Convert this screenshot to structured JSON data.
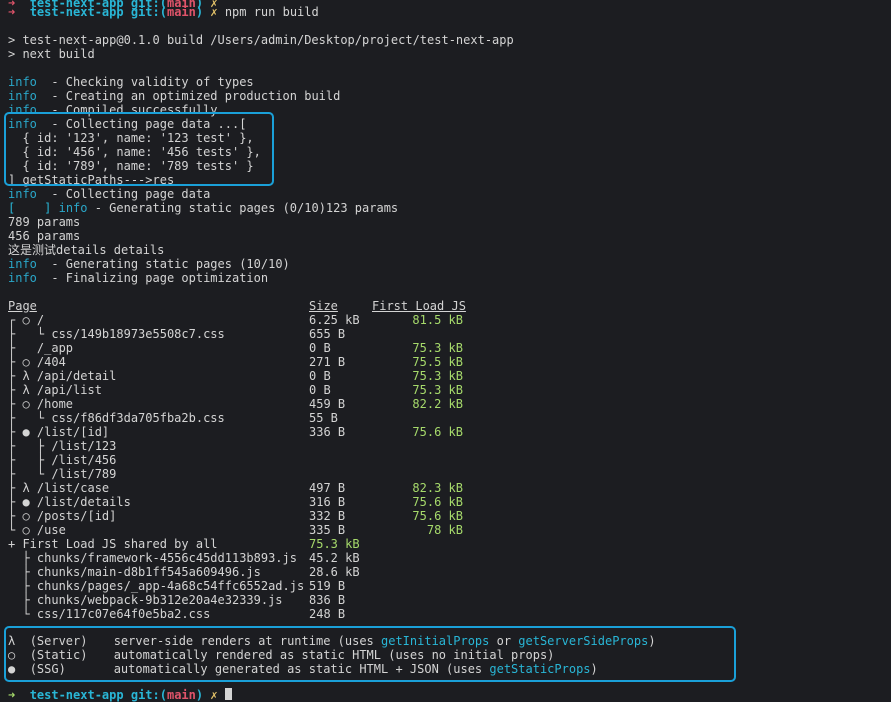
{
  "prompt_top": {
    "arrow": "➜",
    "dir": "test-next-app",
    "git_label": "git:(",
    "branch": "main",
    "git_close": ")",
    "dirty": "✗",
    "command": "npm run build"
  },
  "npm_header": [
    "> test-next-app@0.1.0 build /Users/admin/Desktop/project/test-next-app",
    "> next build"
  ],
  "info_label": "info",
  "info_lines_1": [
    "- Checking validity of types",
    "- Creating an optimized production build",
    "- Compiled successfully",
    "- Collecting page data ...["
  ],
  "paths_output": [
    "  { id: '123', name: '123 test' },",
    "  { id: '456', name: '456 tests' },",
    "  { id: '789', name: '789 tests' }",
    "] getStaticPaths--->res"
  ],
  "collect_line": "- Collecting page data",
  "gen_line": {
    "bracket": "[    ]",
    "label": "info",
    "text": " - Generating static pages (0/10)123 params"
  },
  "params": [
    "789 params",
    "456 params",
    "这是测试details details"
  ],
  "info_lines_2": [
    "- Generating static pages (10/10)",
    "- Finalizing page optimization"
  ],
  "table": {
    "headers": {
      "page": "Page",
      "size": "Size",
      "first_load": "First Load JS"
    },
    "rows": [
      {
        "page": "┌ ○ /",
        "size": "6.25 kB",
        "first": "81.5 kB"
      },
      {
        "page": "├   └ css/149b18973e5508c7.css",
        "size": "655 B",
        "first": ""
      },
      {
        "page": "├   /_app",
        "size": "0 B",
        "first": "75.3 kB"
      },
      {
        "page": "├ ○ /404",
        "size": "271 B",
        "first": "75.5 kB"
      },
      {
        "page": "├ λ /api/detail",
        "size": "0 B",
        "first": "75.3 kB"
      },
      {
        "page": "├ λ /api/list",
        "size": "0 B",
        "first": "75.3 kB"
      },
      {
        "page": "├ ○ /home",
        "size": "459 B",
        "first": "82.2 kB"
      },
      {
        "page": "├   └ css/f86df3da705fba2b.css",
        "size": "55 B",
        "first": ""
      },
      {
        "page": "├ ● /list/[id]",
        "size": "336 B",
        "first": "75.6 kB"
      },
      {
        "page": "├   ├ /list/123",
        "size": "",
        "first": ""
      },
      {
        "page": "├   ├ /list/456",
        "size": "",
        "first": ""
      },
      {
        "page": "├   └ /list/789",
        "size": "",
        "first": ""
      },
      {
        "page": "├ λ /list/case",
        "size": "497 B",
        "first": "82.3 kB"
      },
      {
        "page": "├ ● /list/details",
        "size": "316 B",
        "first": "75.6 kB"
      },
      {
        "page": "├ ○ /posts/[id]",
        "size": "332 B",
        "first": "75.6 kB"
      },
      {
        "page": "└ ○ /use",
        "size": "335 B",
        "first": "78 kB"
      }
    ],
    "shared": {
      "label": "+ First Load JS shared by all",
      "size": "75.3 kB"
    },
    "chunks": [
      {
        "name": "  ├ chunks/framework-4556c45dd113b893.js",
        "size": "45.2 kB"
      },
      {
        "name": "  ├ chunks/main-d8b1ff545a609496.js",
        "size": "28.6 kB"
      },
      {
        "name": "  ├ chunks/pages/_app-4a68c54ffc6552ad.js",
        "size": "519 B"
      },
      {
        "name": "  ├ chunks/webpack-9b312e20a4e32339.js",
        "size": "836 B"
      },
      {
        "name": "  └ css/117c07e64f0e5ba2.css",
        "size": "248 B"
      }
    ]
  },
  "legend": [
    {
      "sym": "λ",
      "kind": "(Server)",
      "text": "server-side renders at runtime (uses ",
      "k1": "getInitialProps",
      "mid": " or ",
      "k2": "getServerSideProps",
      "end": ")"
    },
    {
      "sym": "○",
      "kind": "(Static)",
      "text": "automatically rendered as static HTML (uses no initial props)",
      "k1": "",
      "mid": "",
      "k2": "",
      "end": ""
    },
    {
      "sym": "●",
      "kind": "(SSG)",
      "text": "automatically generated as static HTML + JSON (uses ",
      "k1": "getStaticProps",
      "mid": "",
      "k2": "",
      "end": ")"
    }
  ],
  "prompt_bottom": {
    "arrow": "➜",
    "dir": "test-next-app",
    "git_label": "git:(",
    "branch": "main",
    "git_close": ")",
    "dirty": "✗"
  }
}
